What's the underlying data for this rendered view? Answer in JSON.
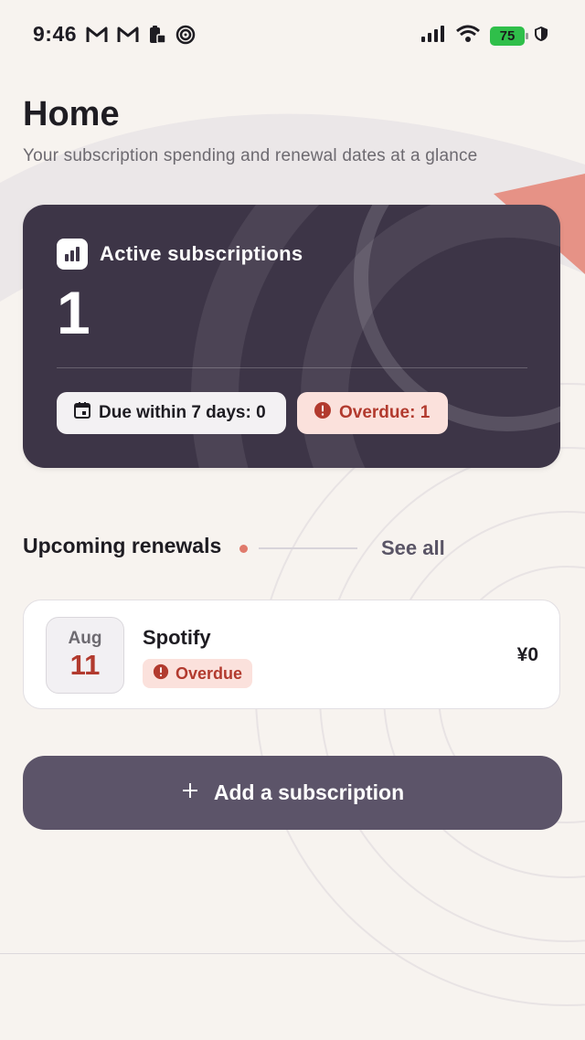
{
  "status_bar": {
    "time": "9:46",
    "battery": "75",
    "left_icons": [
      "gmail-icon",
      "gmail-icon",
      "clipboard-lock-icon",
      "spiral-icon"
    ],
    "right_icons": [
      "signal-icon",
      "wifi-icon",
      "battery-icon",
      "shield-icon"
    ]
  },
  "header": {
    "title": "Home",
    "subtitle": "Your subscription spending and renewal dates at a glance"
  },
  "summary": {
    "label": "Active subscriptions",
    "count": "1",
    "due_chip": "Due within 7 days: 0",
    "overdue_chip": "Overdue: 1"
  },
  "upcoming": {
    "title": "Upcoming renewals",
    "see_all": "See all",
    "items": [
      {
        "month": "Aug",
        "day": "11",
        "name": "Spotify",
        "status": "Overdue",
        "price": "¥0"
      }
    ]
  },
  "actions": {
    "add_label": "Add a subscription"
  },
  "colors": {
    "card_bg": "#3d3547",
    "overdue_red": "#b23a2e",
    "overdue_bg": "#fbe1dc",
    "primary_button": "#5c5469",
    "accent_dot": "#e07a6c"
  }
}
